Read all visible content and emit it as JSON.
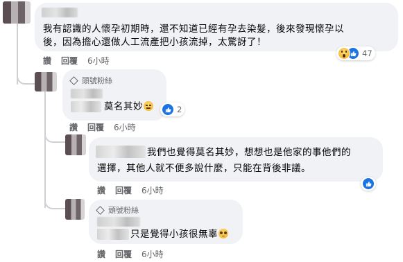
{
  "comments": [
    {
      "text_line1": "我有認識的人懷孕初期時，還不知道已經有孕去染髮，後來發現懷孕以",
      "text_line2": "後，因為擔心還做人工流產把小孩流掉，太驚訝了！",
      "reaction_count": "47",
      "reactions": [
        "wow-icon",
        "like-icon"
      ],
      "actions": {
        "reply": "讚",
        "respond": "回覆",
        "time": "6小時"
      }
    },
    {
      "badge": "頭號粉絲",
      "text": "莫名其妙",
      "emoji": "neutral-face",
      "reaction_count": "2",
      "actions": {
        "reply": "讚",
        "respond": "回覆",
        "time": "6小時"
      }
    },
    {
      "text_line1": "我們也覺得莫名其妙，想想也是他家的事他們的",
      "text_line2": "選擇，其他人就不便多說什麼，只能在背後非議。",
      "actions": {
        "reply": "讚",
        "respond": "回覆",
        "time": "6小時"
      }
    },
    {
      "badge": "頭號粉絲",
      "text": "只是覺得小孩很無辜",
      "emoji": "pleading-face",
      "actions": {
        "reply": "讚",
        "respond": "回覆",
        "time": "6小時"
      }
    }
  ],
  "colors": {
    "like_blue": "#1b74e4",
    "bubble_bg": "#f0f2f5",
    "meta_gray": "#65676b"
  }
}
